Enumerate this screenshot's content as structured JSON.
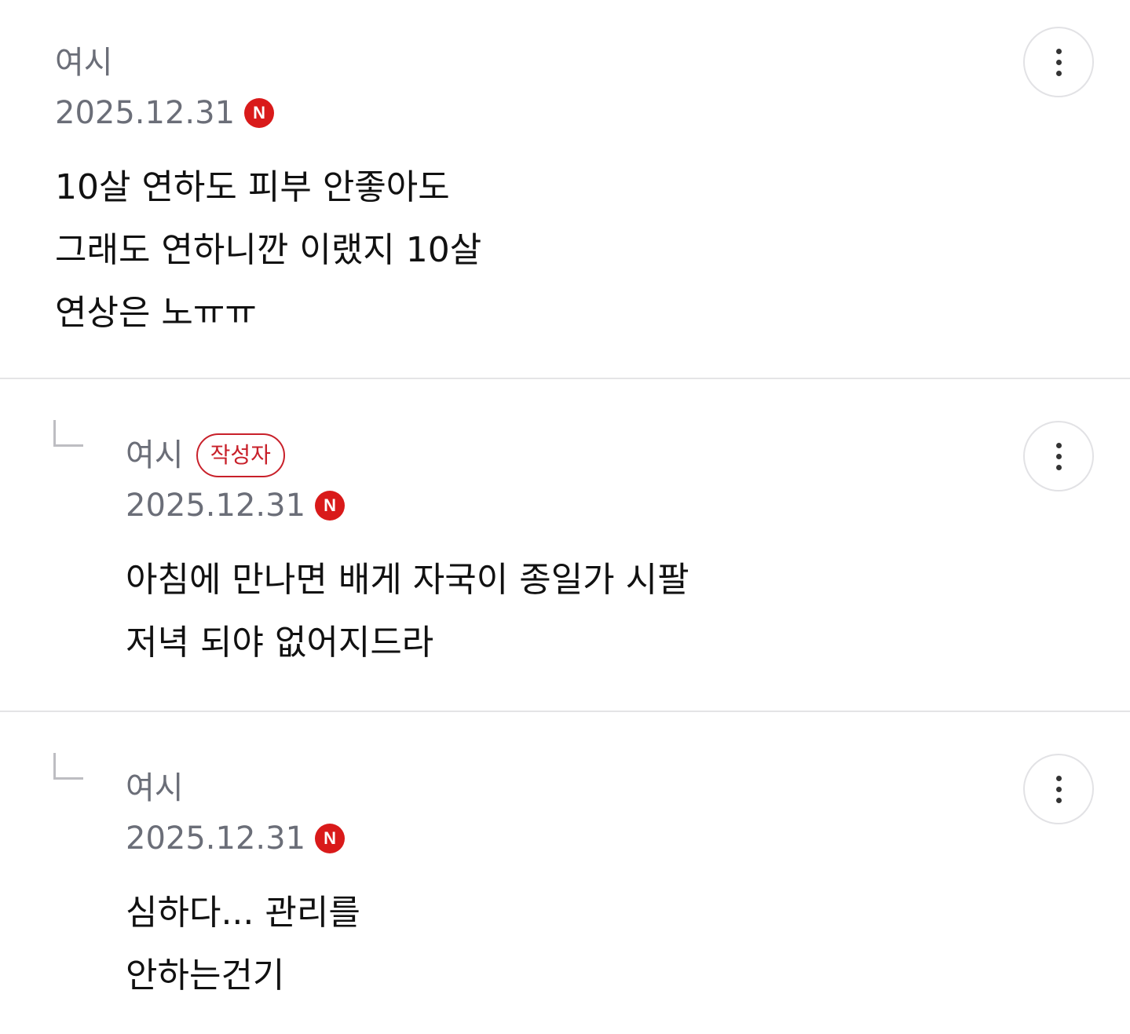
{
  "comments": [
    {
      "author": "여시",
      "date": "2025.12.31",
      "new_icon": "N",
      "lines": [
        "10살 연하도 피부 안좋아도",
        "그래도 연하니깐 이랬지 10살",
        "연상은 노ㅠㅠ"
      ]
    },
    {
      "author": "여시",
      "author_badge": "작성자",
      "date": "2025.12.31",
      "new_icon": "N",
      "lines": [
        "아침에 만나면 배게 자국이 종일가 시팔",
        "저녁 되야 없어지드라"
      ]
    },
    {
      "author": "여시",
      "date": "2025.12.31",
      "new_icon": "N",
      "lines": [
        "심하다... 관리를",
        "안하는건기"
      ]
    }
  ],
  "icons": {
    "more": "more-vertical-icon",
    "reply": "reply-arrow-icon",
    "new": "new-badge-icon"
  },
  "colors": {
    "accent_red": "#c8202a",
    "new_red": "#d91a1a",
    "meta_gray": "#6b6e78",
    "divider": "#e4e4e6"
  }
}
